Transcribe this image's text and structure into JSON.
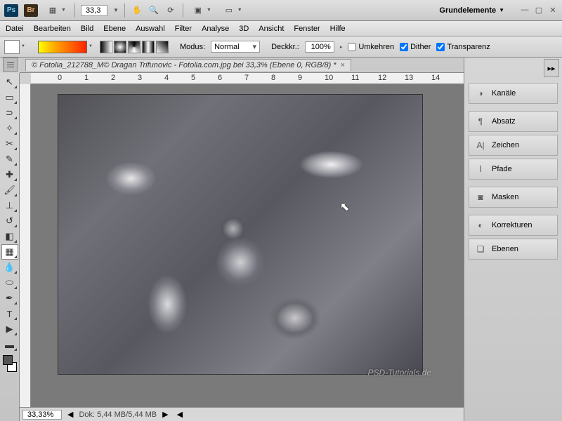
{
  "topbar": {
    "zoom": "33,3",
    "workspace": "Grundelemente"
  },
  "menu": [
    "Datei",
    "Bearbeiten",
    "Bild",
    "Ebene",
    "Auswahl",
    "Filter",
    "Analyse",
    "3D",
    "Ansicht",
    "Fenster",
    "Hilfe"
  ],
  "options": {
    "mode_label": "Modus:",
    "mode_value": "Normal",
    "opacity_label": "Deckkr.:",
    "opacity_value": "100%",
    "reverse": "Umkehren",
    "dither": "Dither",
    "transparency": "Transparenz"
  },
  "doc": {
    "tab": "© Fotolia_212788_M© Dragan Trifunovic - Fotolia.com.jpg bei 33,3% (Ebene 0, RGB/8) *"
  },
  "ruler_marks": [
    "0",
    "1",
    "2",
    "3",
    "4",
    "5",
    "6",
    "7",
    "8",
    "9",
    "10",
    "11",
    "12",
    "13",
    "14"
  ],
  "status": {
    "zoom": "33,33%",
    "doc": "Dok: 5,44 MB/5,44 MB"
  },
  "panels": [
    "Kanäle",
    "Absatz",
    "Zeichen",
    "Pfade",
    "Masken",
    "Korrekturen",
    "Ebenen"
  ],
  "watermark": "PSD-Tutorials.de"
}
